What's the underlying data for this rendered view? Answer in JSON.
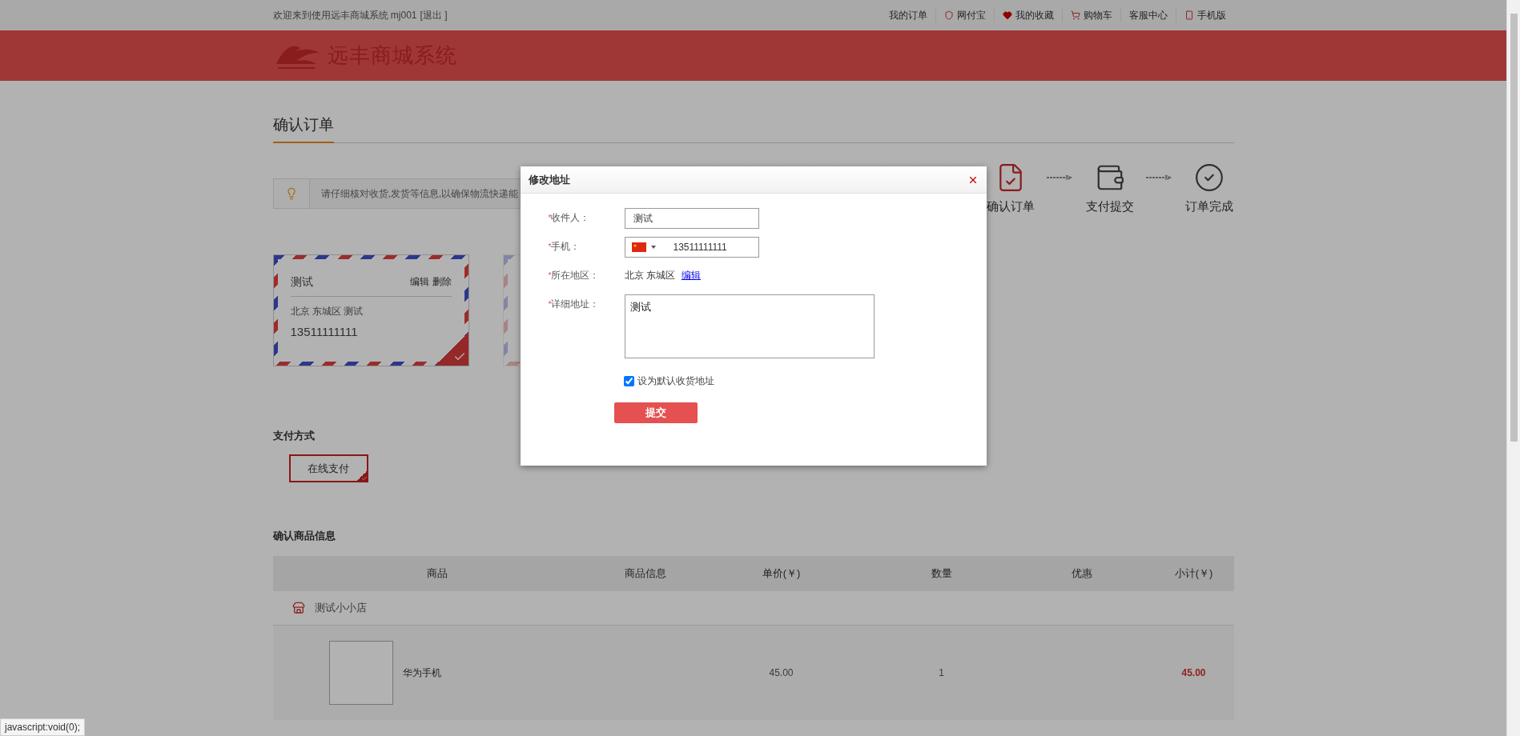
{
  "top_bar": {
    "welcome": "欢迎来到使用远丰商城系统 mj001",
    "logout": "[退出 ]",
    "links": [
      {
        "label": "我的订单"
      },
      {
        "label": "网付宝"
      },
      {
        "label": "我的收藏"
      },
      {
        "label": "购物车"
      },
      {
        "label": "客服中心"
      },
      {
        "label": "手机版"
      }
    ]
  },
  "header": {
    "logo_text": "远丰商城系统"
  },
  "page_title": "确认订单",
  "tip": "请仔细核对收货,发货等信息,以确保物流快递能",
  "steps": [
    {
      "label": "确认订单"
    },
    {
      "label": "支付提交"
    },
    {
      "label": "订单完成"
    }
  ],
  "addresses": [
    {
      "name": "测试",
      "actions": [
        "编辑",
        "删除"
      ],
      "region": "北京 东城区 测试",
      "phone": "13511111111",
      "selected": true
    }
  ],
  "payment": {
    "title": "支付方式",
    "options": [
      {
        "label": "在线支付",
        "selected": true
      }
    ]
  },
  "goods": {
    "title": "确认商品信息",
    "columns": [
      "商品",
      "商品信息",
      "单价(￥)",
      "数量",
      "优惠",
      "小计(￥)"
    ],
    "shop": "测试小小店",
    "rows": [
      {
        "name": "华为手机",
        "price": "45.00",
        "quantity": "1",
        "subtotal": "45.00"
      }
    ]
  },
  "modal": {
    "title": "修改地址",
    "fields": [
      {
        "kind": "text",
        "mark": "*",
        "label": "收件人：",
        "value": "测试"
      },
      {
        "kind": "phone",
        "mark": "*",
        "label": "手机：",
        "value": "13511111111"
      },
      {
        "kind": "region",
        "mark": "*",
        "label": "所在地区：",
        "value": "北京 东城区",
        "link": "编辑"
      },
      {
        "kind": "textarea",
        "mark": "*",
        "label": "详细地址：",
        "value": "测试"
      }
    ],
    "default_checkbox": {
      "label": "设为默认收货地址",
      "checked": true
    },
    "submit": "提交"
  },
  "status_bar": "javascript:void(0);"
}
